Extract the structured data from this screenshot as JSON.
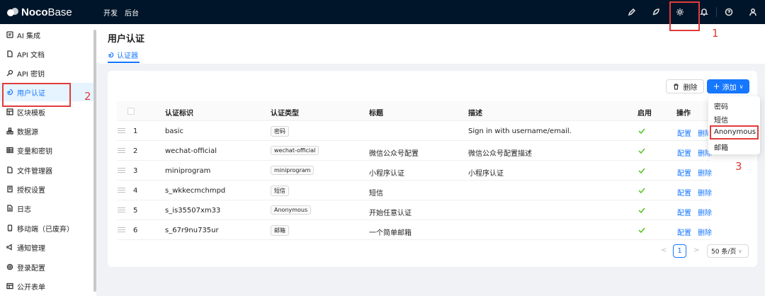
{
  "app": {
    "logo_noco": "Noco",
    "logo_base": "Base",
    "nav": [
      "开发",
      "后台"
    ]
  },
  "top_icons": [
    "pencil-icon",
    "rocket-icon",
    "gear-icon",
    "bell-icon",
    "help-icon",
    "user-icon"
  ],
  "sidebar": {
    "items": [
      {
        "label": "AI 集成",
        "icon": "ai-icon"
      },
      {
        "label": "API 文档",
        "icon": "doc-icon"
      },
      {
        "label": "API 密钥",
        "icon": "key-icon"
      },
      {
        "label": "用户认证",
        "icon": "login-icon",
        "active": true
      },
      {
        "label": "区块模板",
        "icon": "template-icon"
      },
      {
        "label": "数据源",
        "icon": "database-icon"
      },
      {
        "label": "变量和密钥",
        "icon": "table-icon"
      },
      {
        "label": "文件管理器",
        "icon": "file-icon"
      },
      {
        "label": "授权设置",
        "icon": "license-icon"
      },
      {
        "label": "日志",
        "icon": "log-icon"
      },
      {
        "label": "移动端（已废弃）",
        "icon": "mobile-icon"
      },
      {
        "label": "通知管理",
        "icon": "notification-icon"
      },
      {
        "label": "登录配置",
        "icon": "settings-icon"
      },
      {
        "label": "公开表单",
        "icon": "form-icon"
      }
    ]
  },
  "page": {
    "title": "用户认证",
    "tab": "认证器"
  },
  "toolbar": {
    "delete_label": "删除",
    "add_label": "添加"
  },
  "table": {
    "headers": [
      "认证标识",
      "认证类型",
      "标题",
      "描述",
      "启用",
      "操作"
    ],
    "rows": [
      {
        "index": "1",
        "name": "basic",
        "type": "密码",
        "title": "",
        "description": "Sign in with username/email.",
        "enabled": true,
        "config": "配置",
        "delete": "删除"
      },
      {
        "index": "2",
        "name": "wechat-official",
        "type": "wechat-official",
        "title": "微信公众号配置",
        "description": "微信公众号配置描述",
        "enabled": true,
        "config": "配置",
        "delete": "删除"
      },
      {
        "index": "3",
        "name": "miniprogram",
        "type": "miniprogram",
        "title": "小程序认证",
        "description": "小程序认证",
        "enabled": true,
        "config": "配置",
        "delete": "删除"
      },
      {
        "index": "4",
        "name": "s_wkkecmchmpd",
        "type": "短信",
        "title": "短信",
        "description": "",
        "enabled": true,
        "config": "配置",
        "delete": "删除"
      },
      {
        "index": "5",
        "name": "s_is35507xm33",
        "type": "Anonymous",
        "title": "开始任意认证",
        "description": "",
        "enabled": true,
        "config": "配置",
        "delete": "删除"
      },
      {
        "index": "6",
        "name": "s_67r9nu735ur",
        "type": "邮箱",
        "title": "一个简单邮箱",
        "description": "",
        "enabled": true,
        "config": "配置",
        "delete": "删除"
      }
    ]
  },
  "dropdown": {
    "items": [
      "密码",
      "短信",
      "Anonymous",
      "邮箱"
    ],
    "highlighted": "Anonymous"
  },
  "pagination": {
    "prev": "<",
    "current": "1",
    "next": ">",
    "page_size": "50 条/页"
  },
  "annotations": [
    "1",
    "2",
    "3"
  ],
  "colors": {
    "primary": "#1677ff",
    "header_bg": "#001529",
    "annotation": "#e23b3b",
    "success": "#52c41a"
  }
}
